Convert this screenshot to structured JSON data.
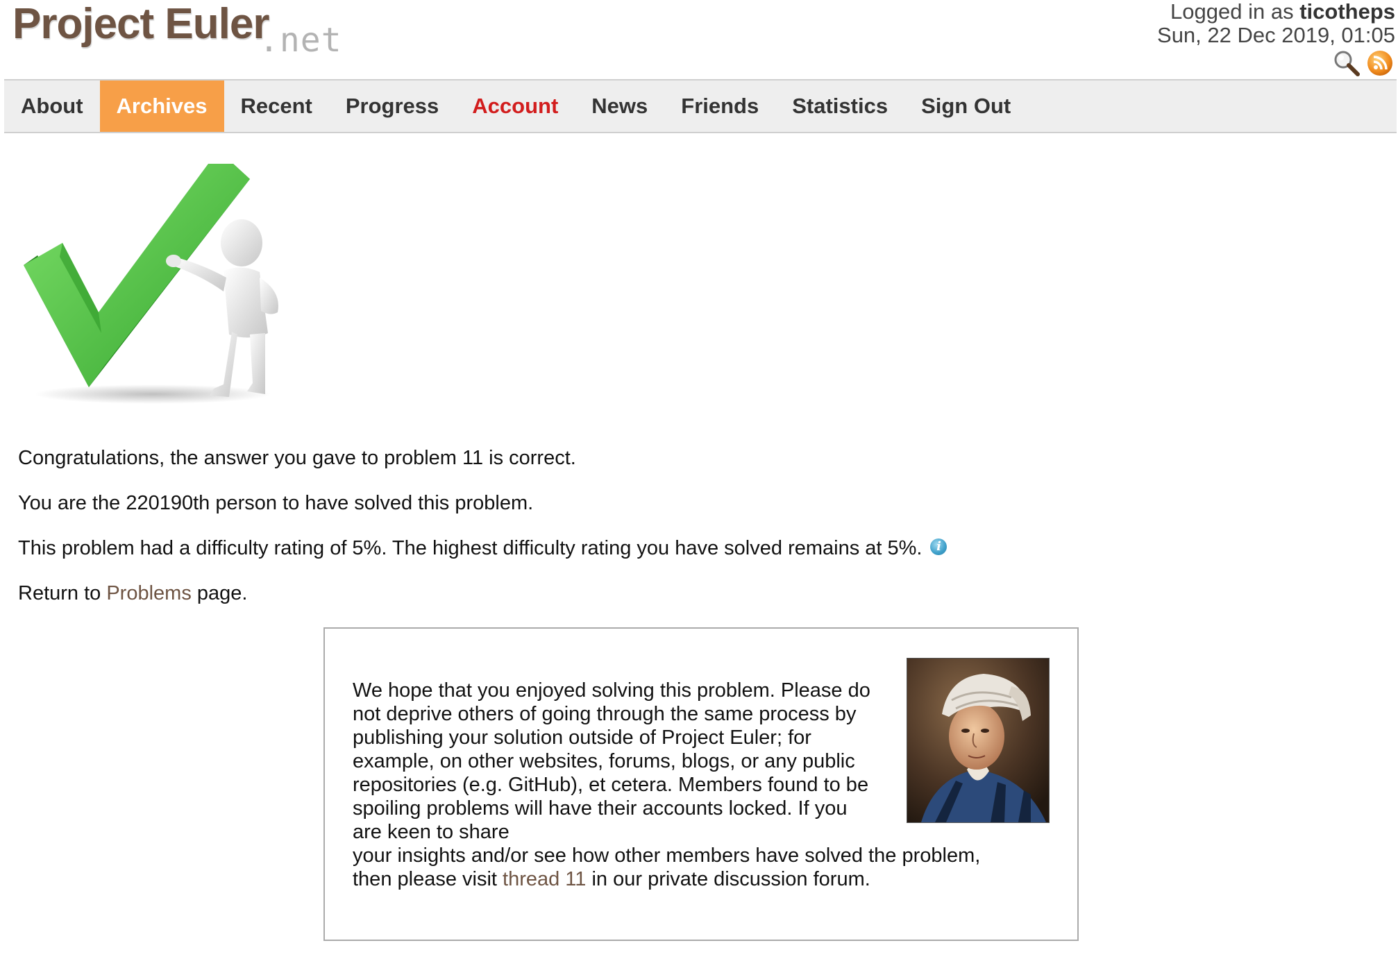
{
  "logo": {
    "main": "Project Euler",
    "suffix": ".net"
  },
  "login": {
    "prefix": "Logged in as ",
    "username": "ticotheps",
    "datetime": "Sun, 22 Dec 2019, 01:05"
  },
  "header_icons": [
    "search-icon",
    "rss-icon"
  ],
  "nav": {
    "items": [
      {
        "label": "About"
      },
      {
        "label": "Archives"
      },
      {
        "label": "Recent"
      },
      {
        "label": "Progress"
      },
      {
        "label": "Account"
      },
      {
        "label": "News"
      },
      {
        "label": "Friends"
      },
      {
        "label": "Statistics"
      },
      {
        "label": "Sign Out"
      }
    ],
    "active": "Archives",
    "highlight": "Account",
    "colors": {
      "active_bg": "#f79f48",
      "highlight_text": "#d21d1d",
      "bar_bg": "#eeeeee"
    }
  },
  "main": {
    "congrats": "Congratulations, the answer you gave to problem 11 is correct.",
    "solver_rank": "You are the 220190th person to have solved this problem.",
    "difficulty": "This problem had a difficulty rating of 5%. The highest difficulty rating you have solved remains at 5%.",
    "return_prefix": "Return to ",
    "return_link": "Problems",
    "return_suffix": " page."
  },
  "message": {
    "line_block": "We hope that you enjoyed solving this problem. Please do not deprive others of going through the same process by publishing your solution outside of Project Euler; for example, on other websites, forums, blogs, or any public repositories (e.g. GitHub), et cetera. Members found to be spoiling problems will have their accounts locked. If you are keen to share",
    "line_wide": "your insights and/or see how other members have solved the problem,",
    "visit_prefix": "then please visit ",
    "thread_link": "thread 11",
    "visit_suffix": " in our private discussion forum."
  },
  "link_color": "#6e5443"
}
